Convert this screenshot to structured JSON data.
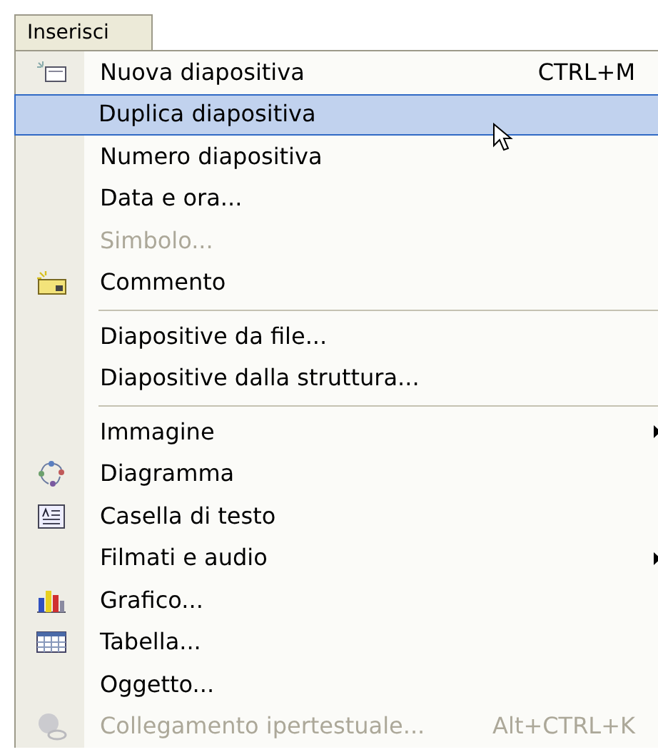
{
  "menu_title": "Inserisci",
  "items": [
    {
      "kind": "command",
      "label": "Nuova diapositiva",
      "shortcut": "CTRL+M",
      "selected": false,
      "disabled": false
    },
    {
      "kind": "command",
      "label": "Duplica diapositiva",
      "selected": true,
      "disabled": false
    },
    {
      "kind": "command",
      "label": "Numero diapositiva",
      "selected": false,
      "disabled": false
    },
    {
      "kind": "command",
      "label": "Data e ora...",
      "selected": false,
      "disabled": false
    },
    {
      "kind": "command",
      "label": "Simbolo...",
      "selected": false,
      "disabled": true
    },
    {
      "kind": "command",
      "label": "Commento",
      "selected": false,
      "disabled": false
    },
    {
      "kind": "separator"
    },
    {
      "kind": "command",
      "label": "Diapositive da file...",
      "selected": false,
      "disabled": false
    },
    {
      "kind": "command",
      "label": "Diapositive dalla struttura...",
      "selected": false,
      "disabled": false
    },
    {
      "kind": "separator"
    },
    {
      "kind": "submenu",
      "label": "Immagine",
      "selected": false,
      "disabled": false
    },
    {
      "kind": "command",
      "label": "Diagramma",
      "selected": false,
      "disabled": false
    },
    {
      "kind": "command",
      "label": "Casella di testo",
      "selected": false,
      "disabled": false
    },
    {
      "kind": "submenu",
      "label": "Filmati e audio",
      "selected": false,
      "disabled": false
    },
    {
      "kind": "command",
      "label": "Grafico...",
      "selected": false,
      "disabled": false
    },
    {
      "kind": "command",
      "label": "Tabella...",
      "selected": false,
      "disabled": false
    },
    {
      "kind": "command",
      "label": "Oggetto...",
      "selected": false,
      "disabled": false
    },
    {
      "kind": "command",
      "label": "Collegamento ipertestuale...",
      "shortcut": "Alt+CTRL+K",
      "selected": false,
      "disabled": true
    }
  ]
}
